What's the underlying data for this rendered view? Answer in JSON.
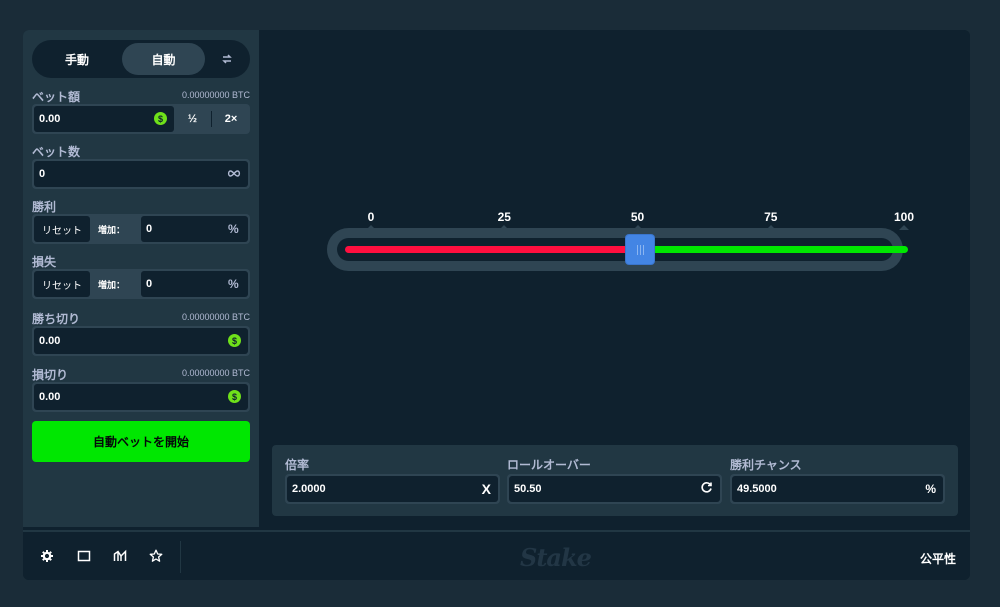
{
  "mode": {
    "manual": "手動",
    "auto": "自動",
    "swap_icon": "swap-icon"
  },
  "bet_amount": {
    "label": "ベット額",
    "sub": "0.00000000 BTC",
    "value": "0.00",
    "half": "½",
    "double": "2×",
    "coin_symbol": "$"
  },
  "bet_count": {
    "label": "ベット数",
    "value": "0",
    "icon": "infinity-icon"
  },
  "on_win": {
    "label": "勝利",
    "reset": "リセット",
    "inc_label": "増加：",
    "value": "0",
    "unit": "%"
  },
  "on_loss": {
    "label": "損失",
    "reset": "リセット",
    "inc_label": "増加：",
    "value": "0",
    "unit": "%"
  },
  "stop_profit": {
    "label": "勝ち切り",
    "sub": "0.00000000 BTC",
    "value": "0.00"
  },
  "stop_loss": {
    "label": "損切り",
    "sub": "0.00000000 BTC",
    "value": "0.00"
  },
  "start_button": "自動ベットを開始",
  "slider": {
    "ticks": [
      "0",
      "25",
      "50",
      "75",
      "100"
    ],
    "value": 50.5,
    "min": 0,
    "max": 100,
    "colors": {
      "lose": "#ff0f3f",
      "win": "#00e701",
      "handle": "#4385e4"
    }
  },
  "stats": {
    "multiplier": {
      "label": "倍率",
      "value": "2.0000",
      "icon": "X"
    },
    "roll_over": {
      "label": "ロールオーバー",
      "value": "50.50"
    },
    "win_chance": {
      "label": "勝利チャンス",
      "value": "49.5000",
      "icon": "%"
    }
  },
  "footer": {
    "logo": "Stake",
    "fairness": "公平性"
  },
  "colors": {
    "bg": "#1a2c38",
    "panel": "#213743",
    "dark": "#0f212e",
    "accent_green": "#00e701"
  }
}
